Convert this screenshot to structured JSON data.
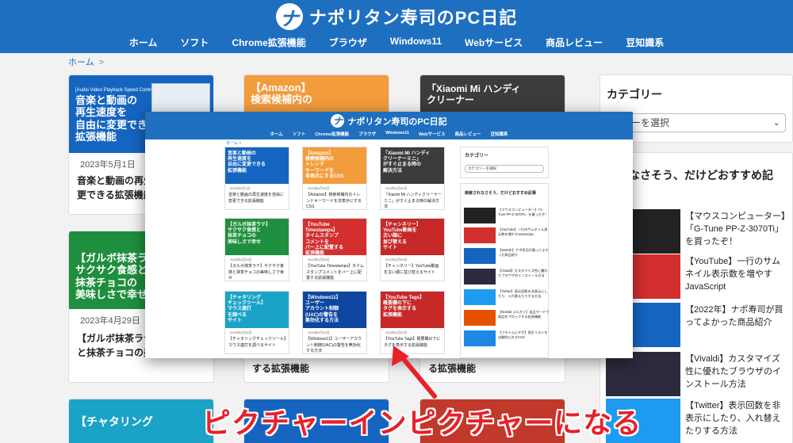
{
  "site": {
    "title": "ナポリタン寿司のPC日記",
    "logo_letter": "ナ",
    "nav": [
      "ホーム",
      "ソフト",
      "Chrome拡張機能",
      "ブラウザ",
      "Windows11",
      "Webサービス",
      "商品レビュー",
      "豆知識系"
    ],
    "breadcrumb": "ホーム",
    "breadcrumb_sep": ">"
  },
  "bg_cards": [
    {
      "thumb_title": "音楽と動画の\n再生速度を\n自由に変更できる\n拡張機能",
      "thumb_top": "[Audio Video Playback Speed Controller]",
      "date": "2023年5月1日",
      "title": "音楽と動画の再生\n更できる拡張機能"
    },
    {
      "thumb_title": "【Amazon】\n検索候補内の",
      "date": "",
      "title": ""
    },
    {
      "thumb_title": "「Xiaomi Mi ハンディ\nクリーナー",
      "date": "",
      "title": ""
    },
    {
      "thumb_title": "【ガルボ抹茶ラテ】\nサクサク食感と\n抹茶チョコの\n美味しさで幸せ",
      "date": "2023年4月29日",
      "title": "【ガルボ抹茶ラテ\nと抹茶チョコの美"
    },
    {
      "thumb_title": "",
      "date": "",
      "title": "る拡張機能"
    },
    {
      "thumb_title": "",
      "date": "",
      "title": "する拡張機能"
    },
    {
      "thumb_title": "【チャタリング",
      "date": "",
      "title": ""
    }
  ],
  "sidebar": {
    "category_heading": "カテゴリー",
    "category_select": "ゴリーを選択",
    "rec_heading": "されなさそう、だけどおすすめ記",
    "rec_items": [
      "【マウスコンピューター】「G-Tune PP-Z-3070Ti」を買ったぞ！",
      "【YouTube】一行のサムネイル表示数を増やすJavaScript",
      "【2022年】ナポ寿司が買ってよかった商品紹介",
      "【Vivaldi】カスタマイズ性に優れたブラウザのインストール方法",
      "【Twitter】表示回数を非表示にしたり、入れ替えたりする方法"
    ]
  },
  "pip": {
    "nav": [
      "ホーム",
      "ソフト",
      "Chrome拡張機能",
      "ブラウザ",
      "Windows11",
      "Webサービス",
      "商品レビュー",
      "豆知識系"
    ],
    "breadcrumb": "ホーム >",
    "cards": [
      {
        "thumb": "音楽と動画の\n再生速度を\n自由に変更できる\n拡張機能",
        "date": "2023年5月1日",
        "title": "音楽と動画の再生速度を自由に変更できる拡張機能"
      },
      {
        "thumb": "【Amazon】\n検索候補内の\nトレンド\nキーワードを\n非表示にするCSS",
        "date": "2023年4月30日",
        "title": "【Amazon】検索候補内のトレンドキーワードを非表示にするCSS"
      },
      {
        "thumb": "「Xiaomi Mi ハンディ\nクリーナーミニ」\nがすぐ止まる時の\n解決方法",
        "date": "2023年4月30日",
        "title": "「Xiaomi Mi ハンディクリーナーミニ」がすぐ止まる時の解決方法"
      },
      {
        "thumb": "【ガルボ抹茶ラテ】\nサクサク食感と\n抹茶チョコの\n美味しさで幸せ",
        "date": "2023年4月29日",
        "title": "【ガルボ抹茶ラテ】サクサク食感と抹茶チョコの美味しさで幸せ"
      },
      {
        "thumb": "【YouTube Timestamps】\nタイムスタンプ\nコメントを\nバー上に配置する\n拡張機能",
        "date": "2023年4月28日",
        "title": "【YouTube Timestamps】タイムスタンプコメントをバー上に配置する拡張機能"
      },
      {
        "thumb": "【チャンネリー】\nYouTube動画を\n古い順に\n並び替える\nサイト",
        "date": "2023年4月28日",
        "title": "【チャンネリー】YouTube動画を古い順に並び替えるサイト"
      },
      {
        "thumb": "【チャタリング\nチェックツール】\nマウス連打\nを調べる\nサイト",
        "date": "2023年4月26日",
        "title": "【チャタリングチェックツール】マウス連打を調べるサイト"
      },
      {
        "thumb": "【Windows11】\nユーザー\nアカウント制御\n(UAC)の警告を\n無効化する方法",
        "date": "2023年4月25日",
        "title": "【Windows11】ユーザーアカウント制御(UAC)の警告を無効化する方法"
      },
      {
        "thumb": "【YouTube Tags】\n概要欄の下に\nタグを表示する\n拡張機能",
        "date": "2023年4月25日",
        "title": "【YouTube Tags】概要欄の下にタグを表示する拡張機能"
      }
    ],
    "category_heading": "カテゴリー",
    "category_select": "カテゴリーを選択",
    "rec_heading": "検索されなさそう、だけどおすすめ記事",
    "rec_items": [
      "【マウスコンピューター】「G-Tune PP-Z-3070Ti」を買ったぞ！",
      "【YouTube】一行のサムネイル表示数を増やすJavaScript",
      "【2022年】ナポ寿司が買ってよかった商品紹介",
      "【Vivaldi】カスタマイズ性に優れたブラウザのインストール方法",
      "【Twitter】表示回数を非表示にしたり、入れ替えたりする方法",
      "【Nosdal メルカリ】出品ワードで商品をブロックする拡張機能",
      "【ブライムビデオ】再生リストを自動的に外すCSS"
    ]
  },
  "annotation": "ピクチャーインピクチャーになる",
  "colors": {
    "header_blue": "#1e6fbf",
    "annotation_red": "#e8202a"
  }
}
